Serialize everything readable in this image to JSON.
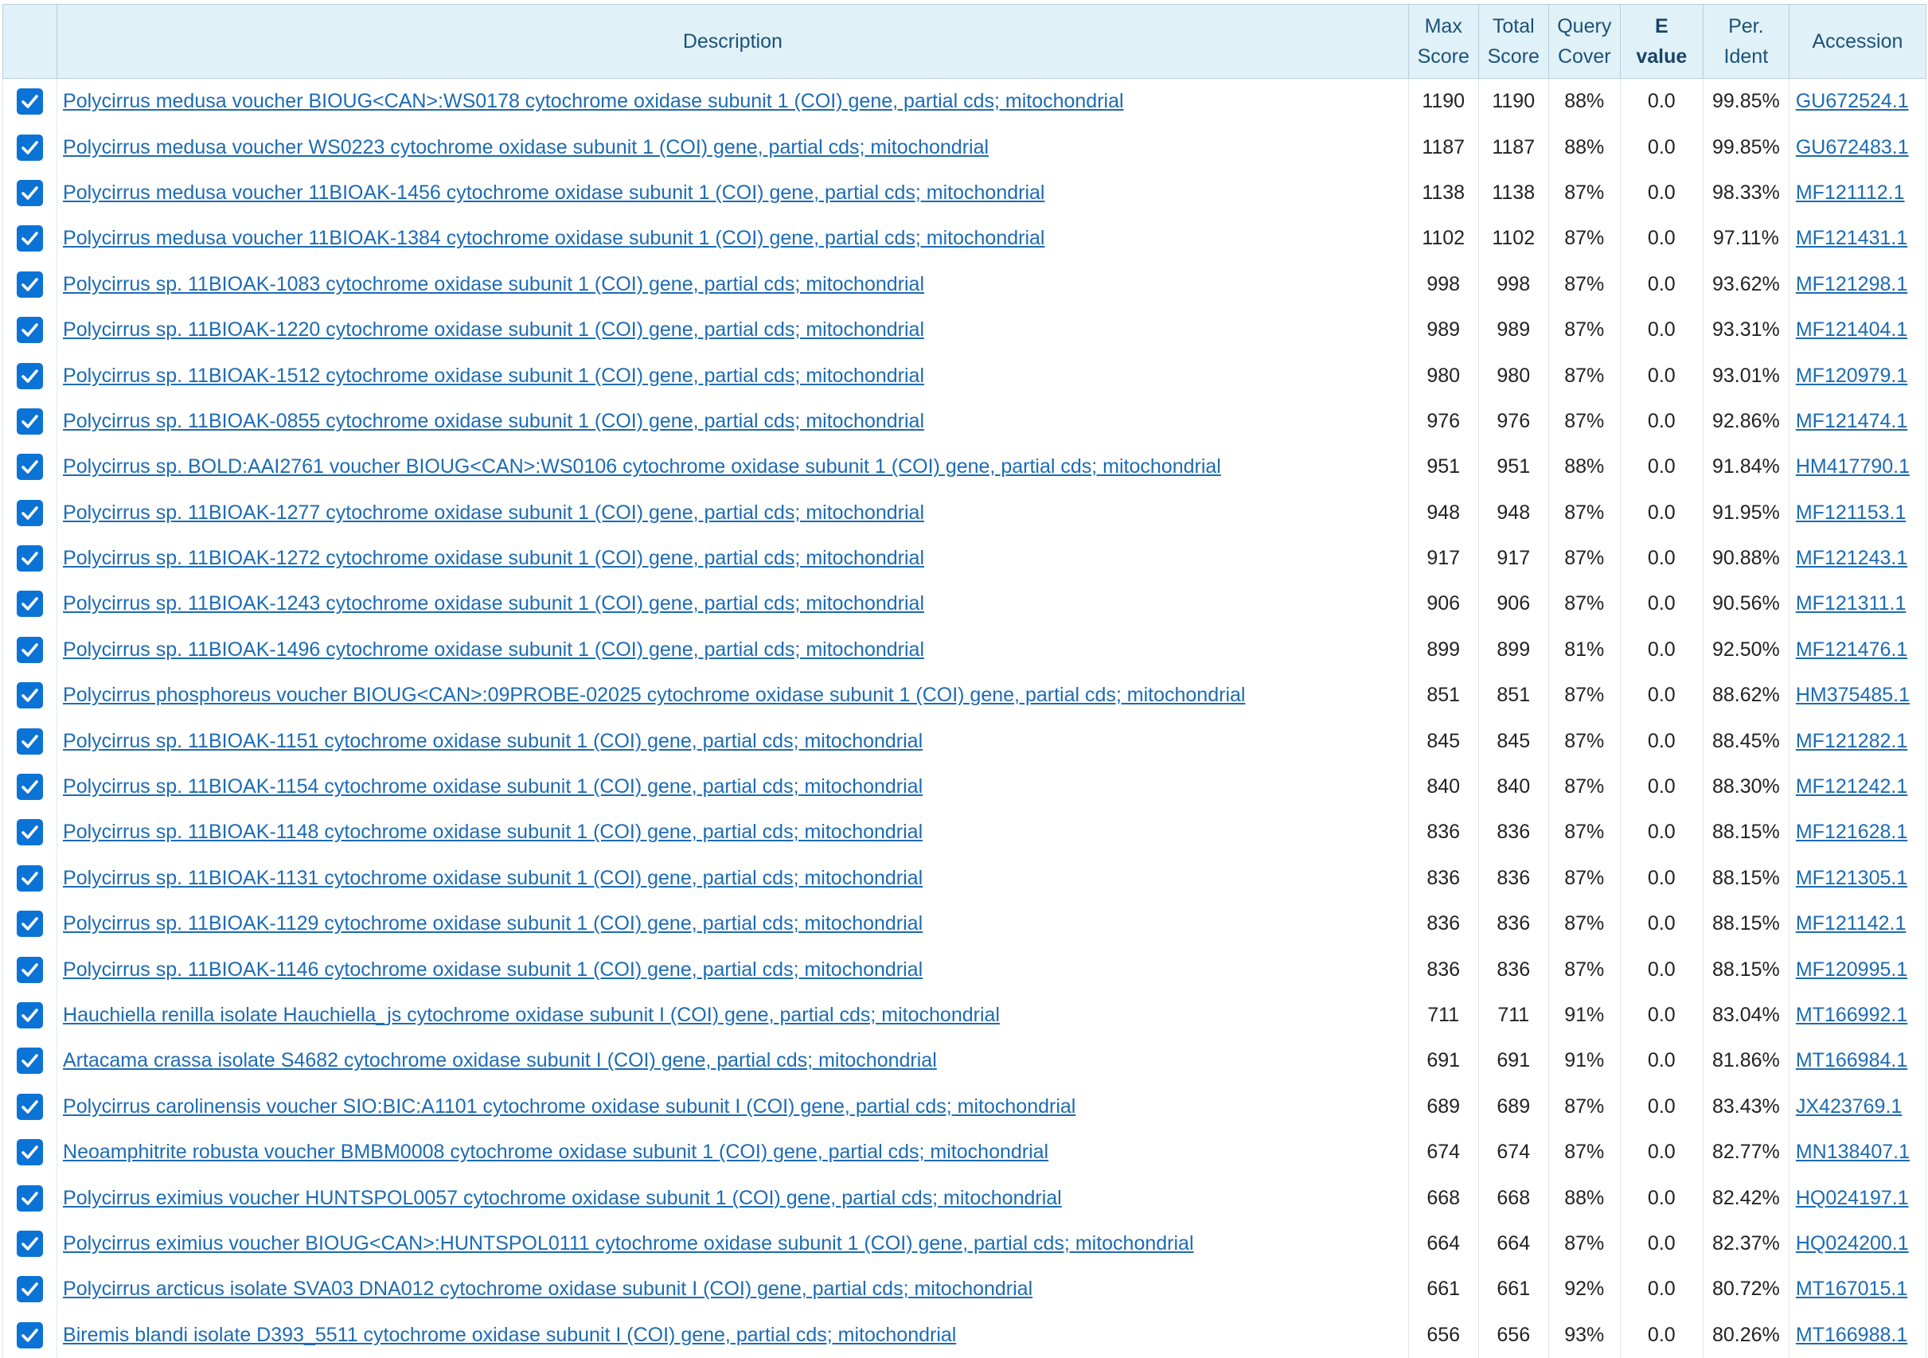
{
  "table": {
    "headers": {
      "description": "Description",
      "max_score": [
        "Max",
        "Score"
      ],
      "total_score": [
        "Total",
        "Score"
      ],
      "query_cover": [
        "Query",
        "Cover"
      ],
      "e_value": [
        "E",
        "value"
      ],
      "per_ident": [
        "Per.",
        "Ident"
      ],
      "accession": "Accession"
    },
    "rows": [
      {
        "checked": true,
        "description": "Polycirrus medusa voucher BIOUG<CAN>:WS0178 cytochrome oxidase subunit 1 (COI) gene, partial cds; mitochondrial",
        "max_score": "1190",
        "total_score": "1190",
        "query_cover": "88%",
        "e_value": "0.0",
        "per_ident": "99.85%",
        "accession": "GU672524.1"
      },
      {
        "checked": true,
        "description": "Polycirrus medusa voucher WS0223 cytochrome oxidase subunit 1 (COI) gene, partial cds; mitochondrial",
        "max_score": "1187",
        "total_score": "1187",
        "query_cover": "88%",
        "e_value": "0.0",
        "per_ident": "99.85%",
        "accession": "GU672483.1"
      },
      {
        "checked": true,
        "description": "Polycirrus medusa voucher 11BIOAK-1456 cytochrome oxidase subunit 1 (COI) gene, partial cds; mitochondrial",
        "max_score": "1138",
        "total_score": "1138",
        "query_cover": "87%",
        "e_value": "0.0",
        "per_ident": "98.33%",
        "accession": "MF121112.1"
      },
      {
        "checked": true,
        "description": "Polycirrus medusa voucher 11BIOAK-1384 cytochrome oxidase subunit 1 (COI) gene, partial cds; mitochondrial",
        "max_score": "1102",
        "total_score": "1102",
        "query_cover": "87%",
        "e_value": "0.0",
        "per_ident": "97.11%",
        "accession": "MF121431.1"
      },
      {
        "checked": true,
        "description": "Polycirrus sp. 11BIOAK-1083 cytochrome oxidase subunit 1 (COI) gene, partial cds; mitochondrial",
        "max_score": "998",
        "total_score": "998",
        "query_cover": "87%",
        "e_value": "0.0",
        "per_ident": "93.62%",
        "accession": "MF121298.1"
      },
      {
        "checked": true,
        "description": "Polycirrus sp. 11BIOAK-1220 cytochrome oxidase subunit 1 (COI) gene, partial cds; mitochondrial",
        "max_score": "989",
        "total_score": "989",
        "query_cover": "87%",
        "e_value": "0.0",
        "per_ident": "93.31%",
        "accession": "MF121404.1"
      },
      {
        "checked": true,
        "description": "Polycirrus sp. 11BIOAK-1512 cytochrome oxidase subunit 1 (COI) gene, partial cds; mitochondrial",
        "max_score": "980",
        "total_score": "980",
        "query_cover": "87%",
        "e_value": "0.0",
        "per_ident": "93.01%",
        "accession": "MF120979.1"
      },
      {
        "checked": true,
        "description": "Polycirrus sp. 11BIOAK-0855 cytochrome oxidase subunit 1 (COI) gene, partial cds; mitochondrial",
        "max_score": "976",
        "total_score": "976",
        "query_cover": "87%",
        "e_value": "0.0",
        "per_ident": "92.86%",
        "accession": "MF121474.1"
      },
      {
        "checked": true,
        "description": "Polycirrus sp. BOLD:AAI2761 voucher BIOUG<CAN>:WS0106 cytochrome oxidase subunit 1 (COI) gene, partial cds; mitochondrial",
        "max_score": "951",
        "total_score": "951",
        "query_cover": "88%",
        "e_value": "0.0",
        "per_ident": "91.84%",
        "accession": "HM417790.1"
      },
      {
        "checked": true,
        "description": "Polycirrus sp. 11BIOAK-1277 cytochrome oxidase subunit 1 (COI) gene, partial cds; mitochondrial",
        "max_score": "948",
        "total_score": "948",
        "query_cover": "87%",
        "e_value": "0.0",
        "per_ident": "91.95%",
        "accession": "MF121153.1"
      },
      {
        "checked": true,
        "description": "Polycirrus sp. 11BIOAK-1272 cytochrome oxidase subunit 1 (COI) gene, partial cds; mitochondrial",
        "max_score": "917",
        "total_score": "917",
        "query_cover": "87%",
        "e_value": "0.0",
        "per_ident": "90.88%",
        "accession": "MF121243.1"
      },
      {
        "checked": true,
        "description": "Polycirrus sp. 11BIOAK-1243 cytochrome oxidase subunit 1 (COI) gene, partial cds; mitochondrial",
        "max_score": "906",
        "total_score": "906",
        "query_cover": "87%",
        "e_value": "0.0",
        "per_ident": "90.56%",
        "accession": "MF121311.1"
      },
      {
        "checked": true,
        "description": "Polycirrus sp. 11BIOAK-1496 cytochrome oxidase subunit 1 (COI) gene, partial cds; mitochondrial",
        "max_score": "899",
        "total_score": "899",
        "query_cover": "81%",
        "e_value": "0.0",
        "per_ident": "92.50%",
        "accession": "MF121476.1"
      },
      {
        "checked": true,
        "description": "Polycirrus phosphoreus voucher BIOUG<CAN>:09PROBE-02025 cytochrome oxidase subunit 1 (COI) gene, partial cds; mitochondrial",
        "max_score": "851",
        "total_score": "851",
        "query_cover": "87%",
        "e_value": "0.0",
        "per_ident": "88.62%",
        "accession": "HM375485.1"
      },
      {
        "checked": true,
        "description": "Polycirrus sp. 11BIOAK-1151 cytochrome oxidase subunit 1 (COI) gene, partial cds; mitochondrial",
        "max_score": "845",
        "total_score": "845",
        "query_cover": "87%",
        "e_value": "0.0",
        "per_ident": "88.45%",
        "accession": "MF121282.1"
      },
      {
        "checked": true,
        "description": "Polycirrus sp. 11BIOAK-1154 cytochrome oxidase subunit 1 (COI) gene, partial cds; mitochondrial",
        "max_score": "840",
        "total_score": "840",
        "query_cover": "87%",
        "e_value": "0.0",
        "per_ident": "88.30%",
        "accession": "MF121242.1"
      },
      {
        "checked": true,
        "description": "Polycirrus sp. 11BIOAK-1148 cytochrome oxidase subunit 1 (COI) gene, partial cds; mitochondrial",
        "max_score": "836",
        "total_score": "836",
        "query_cover": "87%",
        "e_value": "0.0",
        "per_ident": "88.15%",
        "accession": "MF121628.1"
      },
      {
        "checked": true,
        "description": "Polycirrus sp. 11BIOAK-1131 cytochrome oxidase subunit 1 (COI) gene, partial cds; mitochondrial",
        "max_score": "836",
        "total_score": "836",
        "query_cover": "87%",
        "e_value": "0.0",
        "per_ident": "88.15%",
        "accession": "MF121305.1"
      },
      {
        "checked": true,
        "description": "Polycirrus sp. 11BIOAK-1129 cytochrome oxidase subunit 1 (COI) gene, partial cds; mitochondrial",
        "max_score": "836",
        "total_score": "836",
        "query_cover": "87%",
        "e_value": "0.0",
        "per_ident": "88.15%",
        "accession": "MF121142.1"
      },
      {
        "checked": true,
        "description": "Polycirrus sp. 11BIOAK-1146 cytochrome oxidase subunit 1 (COI) gene, partial cds; mitochondrial",
        "max_score": "836",
        "total_score": "836",
        "query_cover": "87%",
        "e_value": "0.0",
        "per_ident": "88.15%",
        "accession": "MF120995.1"
      },
      {
        "checked": true,
        "description": "Hauchiella renilla isolate Hauchiella_js cytochrome oxidase subunit I (COI) gene, partial cds; mitochondrial",
        "max_score": "711",
        "total_score": "711",
        "query_cover": "91%",
        "e_value": "0.0",
        "per_ident": "83.04%",
        "accession": "MT166992.1"
      },
      {
        "checked": true,
        "description": "Artacama crassa isolate S4682 cytochrome oxidase subunit I (COI) gene, partial cds; mitochondrial",
        "max_score": "691",
        "total_score": "691",
        "query_cover": "91%",
        "e_value": "0.0",
        "per_ident": "81.86%",
        "accession": "MT166984.1"
      },
      {
        "checked": true,
        "description": "Polycirrus carolinensis voucher SIO:BIC:A1101 cytochrome oxidase subunit I (COI) gene, partial cds; mitochondrial",
        "max_score": "689",
        "total_score": "689",
        "query_cover": "87%",
        "e_value": "0.0",
        "per_ident": "83.43%",
        "accession": "JX423769.1"
      },
      {
        "checked": true,
        "description": "Neoamphitrite robusta voucher BMBM0008 cytochrome oxidase subunit 1 (COI) gene, partial cds; mitochondrial",
        "max_score": "674",
        "total_score": "674",
        "query_cover": "87%",
        "e_value": "0.0",
        "per_ident": "82.77%",
        "accession": "MN138407.1"
      },
      {
        "checked": true,
        "description": "Polycirrus eximius voucher HUNTSPOL0057 cytochrome oxidase subunit 1 (COI) gene, partial cds; mitochondrial",
        "max_score": "668",
        "total_score": "668",
        "query_cover": "88%",
        "e_value": "0.0",
        "per_ident": "82.42%",
        "accession": "HQ024197.1"
      },
      {
        "checked": true,
        "description": "Polycirrus eximius voucher BIOUG<CAN>:HUNTSPOL0111 cytochrome oxidase subunit 1 (COI) gene, partial cds; mitochondrial",
        "max_score": "664",
        "total_score": "664",
        "query_cover": "87%",
        "e_value": "0.0",
        "per_ident": "82.37%",
        "accession": "HQ024200.1"
      },
      {
        "checked": true,
        "description": "Polycirrus arcticus isolate SVA03 DNA012 cytochrome oxidase subunit I (COI) gene, partial cds; mitochondrial",
        "max_score": "661",
        "total_score": "661",
        "query_cover": "92%",
        "e_value": "0.0",
        "per_ident": "80.72%",
        "accession": "MT167015.1"
      },
      {
        "checked": true,
        "description": "Biremis blandi isolate D393_5511 cytochrome oxidase subunit I (COI) gene, partial cds; mitochondrial",
        "max_score": "656",
        "total_score": "656",
        "query_cover": "93%",
        "e_value": "0.0",
        "per_ident": "80.26%",
        "accession": "MT166988.1"
      }
    ]
  },
  "colors": {
    "header_bg": "#e1f1f8",
    "header_text": "#1a5277",
    "link": "#1c6bb4",
    "checkbox": "#0b73d6"
  },
  "icons": {
    "checkbox": "checkmark-icon"
  }
}
